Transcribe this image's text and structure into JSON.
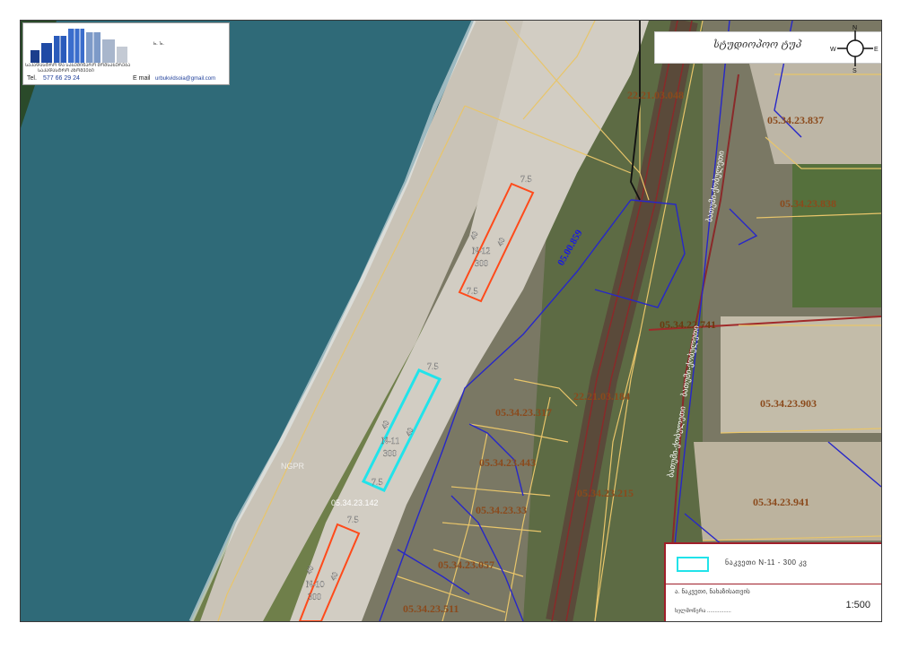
{
  "logo": {
    "company_line1": "ᲡᲐᲙᲐᲓᲐᲡᲢᲠᲝ ᲓᲐ ᲡᲐᲡᲔᲛᲘᲜᲐᲠᲝ ᲛᲝᲛᲡᲐᲮᲣᲠᲔᲑᲐ",
    "company_line2": "ᲡᲐᲙᲐᲓᲐᲡᲢᲠᲝ ᲐᲖᲝᲛᲕᲔᲑᲘ",
    "ln": "ь. ъ.",
    "tel_label": "Tel.",
    "tel_value": "577 66 29 24",
    "email_label": "E mail",
    "email_value": "urbukvidsoia@gmail.com"
  },
  "compass": {
    "title": "სტუდიოპოო ტუპ",
    "n": "N",
    "s": "S",
    "e": "E",
    "w": "W"
  },
  "parcels": {
    "p1": "22.21.03.048",
    "p2": "05.34.23.837",
    "p3": "05.34.23.838",
    "p4": "05.34.22.741",
    "p5": "22.21.03.184",
    "p6": "05.34.23.903",
    "p7": "05.34.23.317",
    "p8": "05.34.23.443",
    "p9": "05.34.23.215",
    "p10": "05.34.23.941",
    "p11": "05.34.23.33",
    "p12": "05.34.23.057",
    "p13": "05.34.23.511",
    "p14": "05.34.23.142"
  },
  "line_label": "05.00.859",
  "road_labels": {
    "r1": "ბათუმი-ქობულეთი",
    "r2": "ბათუმი-ქობულეთი",
    "r3": "ბათუმი-ქობულეთი"
  },
  "plots": {
    "n12": {
      "name": "N-12",
      "area": "300",
      "top": "7.5",
      "bottom": "7.5",
      "side_a": "40",
      "side_b": "40"
    },
    "n11": {
      "name": "N-11",
      "area": "300",
      "top": "7.5",
      "bottom": "7.5",
      "side_a": "40",
      "side_b": "40"
    },
    "n10": {
      "name": "N-10",
      "area": "300",
      "top": "7.5",
      "side_a": "40",
      "side_b": "40"
    }
  },
  "sea_label": "NGPR",
  "legend": {
    "label": "ნაკვეთი N-11 - 300 კვ",
    "sub": "ა. ნაკვეთი, ნახაზისათვის",
    "sign": "ხელმოწერა ................",
    "scale": "1:500"
  },
  "colors": {
    "sea": "#2f6a78",
    "beach": "#c8c2b6",
    "parcel_line": "#e8c56a",
    "boundary_line": "#2727c8",
    "plot_selected": "#21e3ea",
    "plot_other": "#ff4a1a",
    "railway": "#8a2a2a",
    "label": "#8b4a1c"
  }
}
